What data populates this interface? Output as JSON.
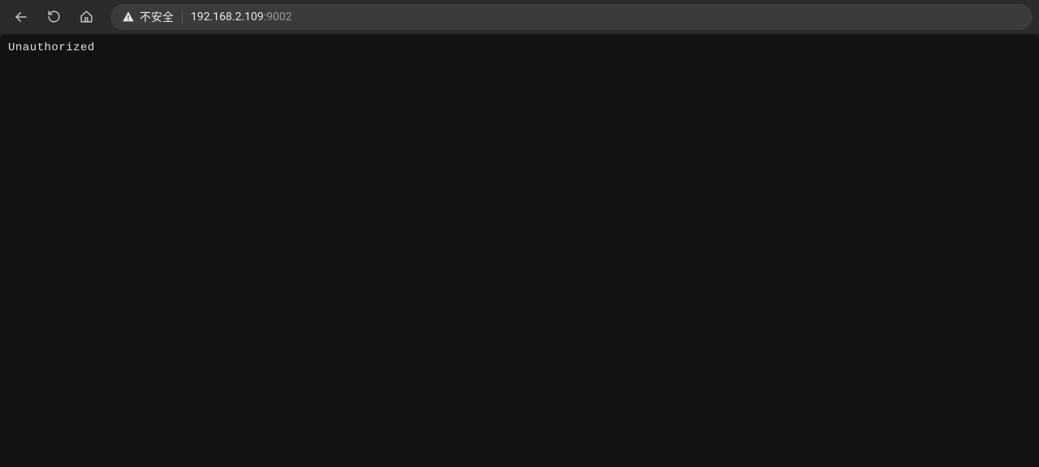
{
  "addressBar": {
    "securityLabel": "不安全",
    "host": "192.168.2.109",
    "port": ":9002"
  },
  "page": {
    "bodyText": "Unauthorized"
  }
}
